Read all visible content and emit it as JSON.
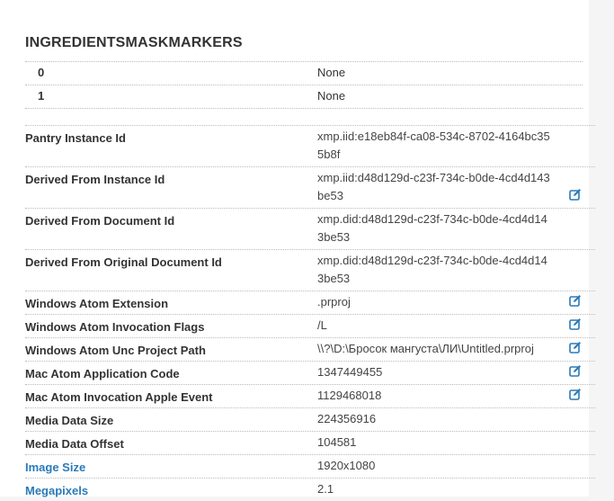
{
  "section": {
    "title": "INGREDIENTSMASKMARKERS",
    "rows": [
      {
        "key": "0",
        "value": "None"
      },
      {
        "key": "1",
        "value": "None"
      }
    ]
  },
  "metadata": {
    "rows": [
      {
        "label": "Pantry Instance Id",
        "value": "xmp.iid:e18eb84f-ca08-534c-8702-4164bc355b8f"
      },
      {
        "label": "Derived From Instance Id",
        "value": "xmp.iid:d48d129d-c23f-734c-b0de-4cd4d143be53"
      },
      {
        "label": "Derived From Document Id",
        "value": "xmp.did:d48d129d-c23f-734c-b0de-4cd4d143be53"
      },
      {
        "label": "Derived From Original Document Id",
        "value": "xmp.did:d48d129d-c23f-734c-b0de-4cd4d143be53"
      },
      {
        "label": "Windows Atom Extension",
        "value": ".prproj"
      },
      {
        "label": "Windows Atom Invocation Flags",
        "value": "/L"
      },
      {
        "label": "Windows Atom Unc Project Path",
        "value": "\\\\?\\D:\\Бросок мангуста\\ЛИ\\Untitled.prproj"
      },
      {
        "label": "Mac Atom Application Code",
        "value": "1347449455"
      },
      {
        "label": "Mac Atom Invocation Apple Event",
        "value": "1129468018"
      },
      {
        "label": "Media Data Size",
        "value": "224356916"
      },
      {
        "label": "Media Data Offset",
        "value": "104581"
      },
      {
        "label": "Image Size",
        "value": "1920x1080"
      },
      {
        "label": "Megapixels",
        "value": "2.1"
      }
    ]
  },
  "icons": {
    "edit": "edit-icon"
  },
  "colors": {
    "link": "#2a7ab8",
    "icon": "#2a7ab8"
  }
}
